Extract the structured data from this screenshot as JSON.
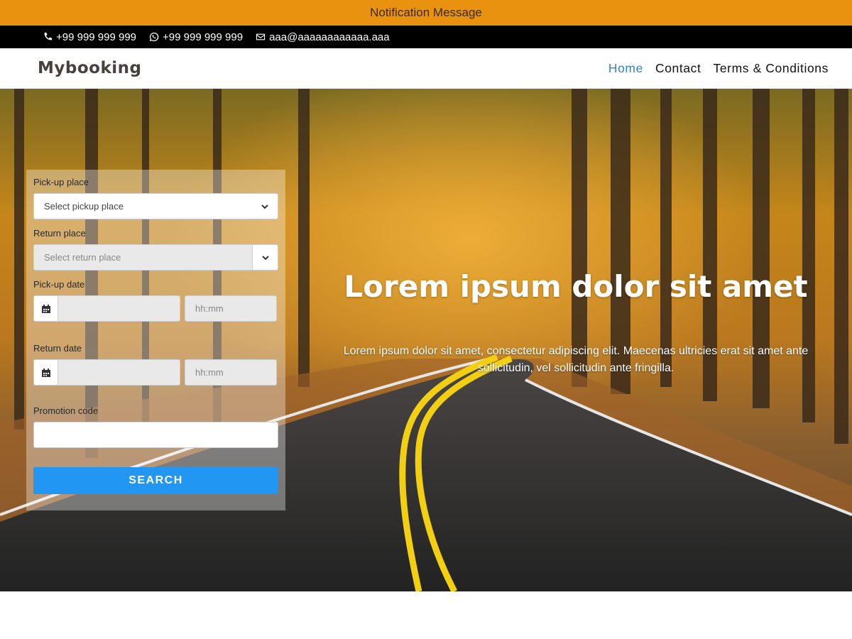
{
  "notification": {
    "text": "Notification Message"
  },
  "topbar": {
    "phone": "+99 999 999 999",
    "whatsapp": "+99 999 999 999",
    "email": "aaa@aaaaaaaaaaaa.aaa"
  },
  "navbar": {
    "brand": "Mybooking",
    "menu": [
      {
        "label": "Home",
        "active": true
      },
      {
        "label": "Contact",
        "active": false
      },
      {
        "label": "Terms & Conditions",
        "active": false
      }
    ]
  },
  "form": {
    "pickup_place_label": "Pick-up place",
    "pickup_place_value": "Select pickup place",
    "return_place_label": "Return place",
    "return_place_value": "Select return place",
    "pickup_date_label": "Pick-up date",
    "pickup_time_placeholder": "hh:mm",
    "return_date_label": "Return date",
    "return_time_placeholder": "hh:mm",
    "promo_label": "Promotion code",
    "search_label": "SEARCH"
  },
  "hero": {
    "title": "Lorem ipsum dolor sit amet",
    "subtitle": "Lorem ipsum dolor sit amet, consectetur adipiscing elit. Maecenas ultricies erat sit amet ante sollicitudin, vel sollicitudin ante fringilla."
  },
  "colors": {
    "notification_bg": "#e8920f",
    "topbar_bg": "#000000",
    "accent": "#2a86c8",
    "search_button": "#2196f3"
  }
}
